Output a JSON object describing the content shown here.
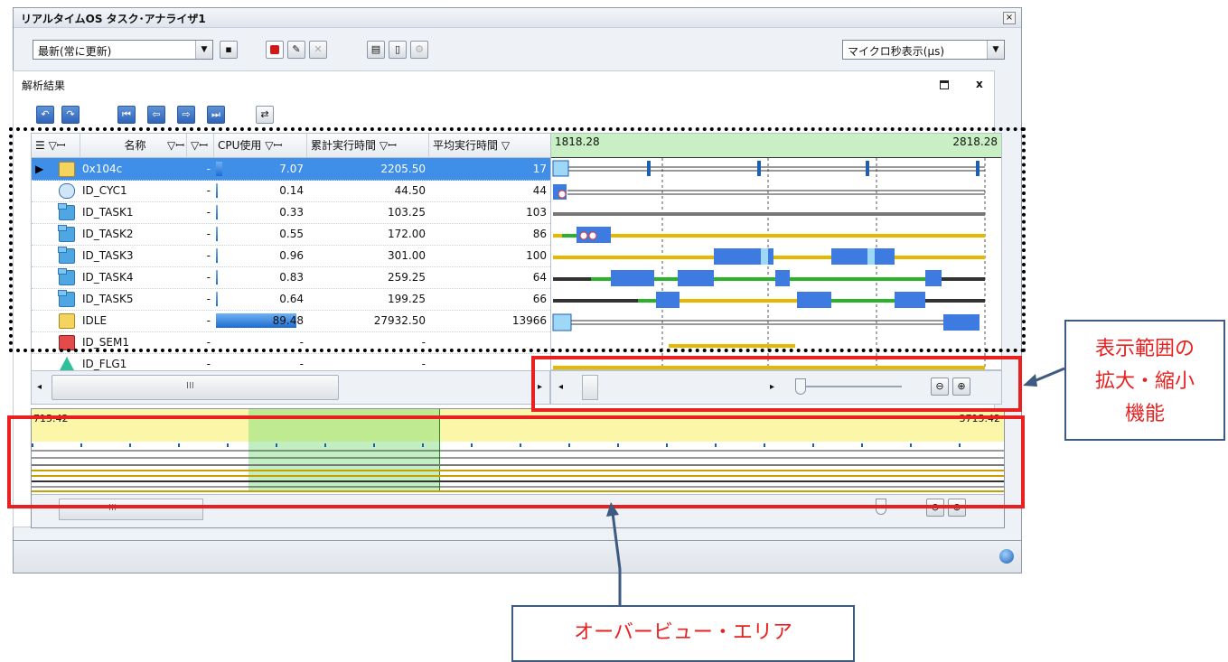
{
  "window": {
    "title": "リアルタイムOS タスク･アナライザ1",
    "close": "×"
  },
  "toolbar": {
    "mode_select": "最新(常に更新)",
    "unit_select": "マイクロ秒表示(μs)"
  },
  "panel": {
    "title": "解析結果",
    "close": "x"
  },
  "table": {
    "headers": [
      "名称",
      "CPU使用",
      "累計実行時間",
      "平均実行時間"
    ],
    "filter_glyph": "▽ꟷ",
    "rows": [
      {
        "name": "0x104c",
        "dash": "-",
        "cpu": "7.07",
        "cpu_pct": 7.07,
        "total": "2205.50",
        "avg": "17",
        "type": "isr",
        "selected": true
      },
      {
        "name": "ID_CYC1",
        "dash": "-",
        "cpu": "0.14",
        "cpu_pct": 0.14,
        "total": "44.50",
        "avg": "44",
        "type": "cyc"
      },
      {
        "name": "ID_TASK1",
        "dash": "-",
        "cpu": "0.33",
        "cpu_pct": 0.33,
        "total": "103.25",
        "avg": "103",
        "type": "task"
      },
      {
        "name": "ID_TASK2",
        "dash": "-",
        "cpu": "0.55",
        "cpu_pct": 0.55,
        "total": "172.00",
        "avg": "86",
        "type": "task"
      },
      {
        "name": "ID_TASK3",
        "dash": "-",
        "cpu": "0.96",
        "cpu_pct": 0.96,
        "total": "301.00",
        "avg": "100",
        "type": "task"
      },
      {
        "name": "ID_TASK4",
        "dash": "-",
        "cpu": "0.83",
        "cpu_pct": 0.83,
        "total": "259.25",
        "avg": "64",
        "type": "task"
      },
      {
        "name": "ID_TASK5",
        "dash": "-",
        "cpu": "0.64",
        "cpu_pct": 0.64,
        "total": "199.25",
        "avg": "66",
        "type": "task"
      },
      {
        "name": "IDLE",
        "dash": "-",
        "cpu": "89.48",
        "cpu_pct": 89.48,
        "total": "27932.50",
        "avg": "13966",
        "type": "isr"
      },
      {
        "name": "ID_SEM1",
        "dash": "-",
        "cpu": "-",
        "cpu_pct": 0,
        "total": "-",
        "avg": "",
        "type": "sem"
      },
      {
        "name": "ID_FLG1",
        "dash": "-",
        "cpu": "-",
        "cpu_pct": 0,
        "total": "-",
        "avg": "",
        "type": "flg"
      }
    ],
    "scroll_mark": "III"
  },
  "timeline": {
    "start": "1818.28",
    "end": "2818.28"
  },
  "overview": {
    "start": "715.42",
    "end": "3715.42",
    "scroll_mark": "III"
  },
  "annotations": {
    "zoom_callout": [
      "表示範囲の",
      "拡大・縮小",
      "機能"
    ],
    "overview_callout": "オーバービュー・エリア"
  },
  "colors": {
    "selection": "#3f8fe8",
    "timeline_header": "#c9f0c4",
    "callout_text": "#e8201f",
    "callout_border": "#3d5a80"
  }
}
